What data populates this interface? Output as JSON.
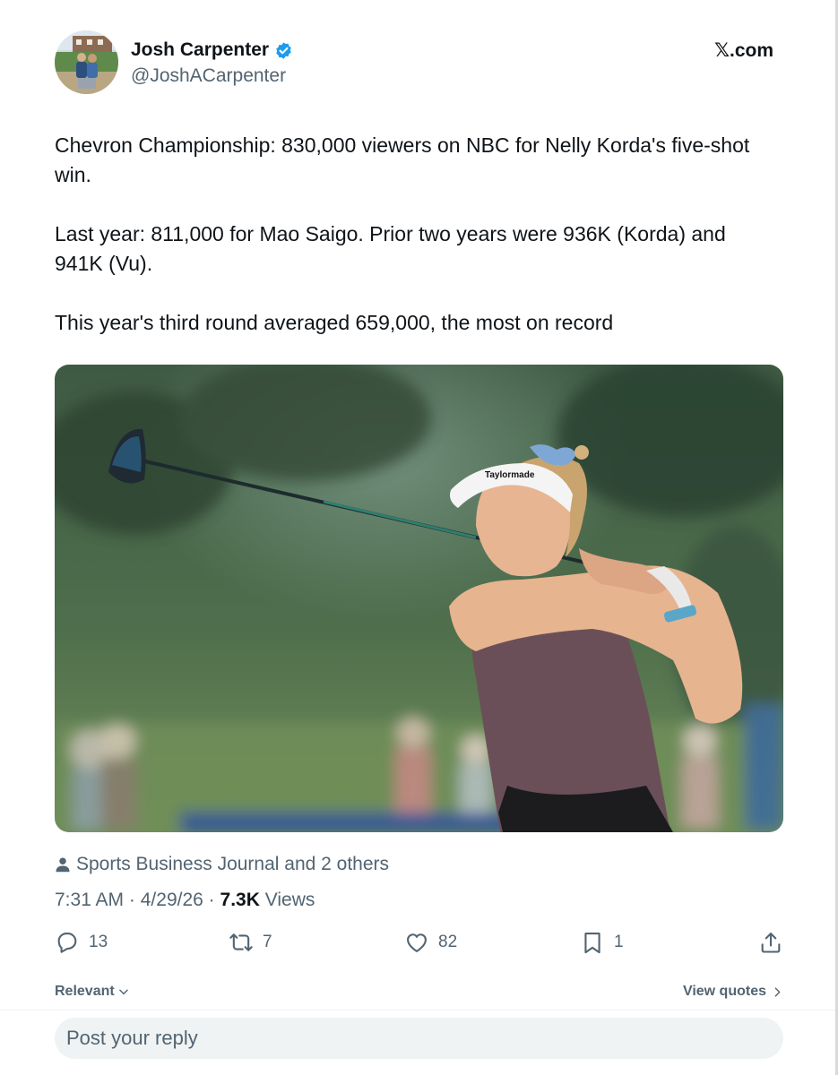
{
  "author": {
    "display_name": "Josh Carpenter",
    "handle": "@JoshACarpenter",
    "verified": true
  },
  "site_label": "𝕏.com",
  "tweet": {
    "paragraphs": [
      "Chevron Championship: 830,000 viewers on NBC for Nelly Korda's five-shot win.",
      "Last year: 811,000 for Mao Saigo. Prior two years were 936K (Korda) and 941K (Vu).",
      "This year's third round averaged 659,000, the most on record"
    ]
  },
  "media": {
    "icon": "photo-golfer-swing",
    "visor_text": "Taylormade"
  },
  "attribution": {
    "text": "Sports Business Journal and 2 others"
  },
  "meta": {
    "time": "7:31 AM",
    "date": "4/29/26",
    "separator": "·",
    "views_count": "7.3K",
    "views_label": "Views"
  },
  "actions": {
    "replies": "13",
    "reposts": "7",
    "likes": "82",
    "bookmarks": "1"
  },
  "filters": {
    "sort_label": "Relevant",
    "quotes_label": "View quotes"
  },
  "reply": {
    "placeholder": "Post your reply"
  },
  "colors": {
    "text_primary": "#0f1419",
    "text_secondary": "#536471",
    "verified_blue": "#1d9bf0",
    "reply_bg": "#eff3f4"
  }
}
